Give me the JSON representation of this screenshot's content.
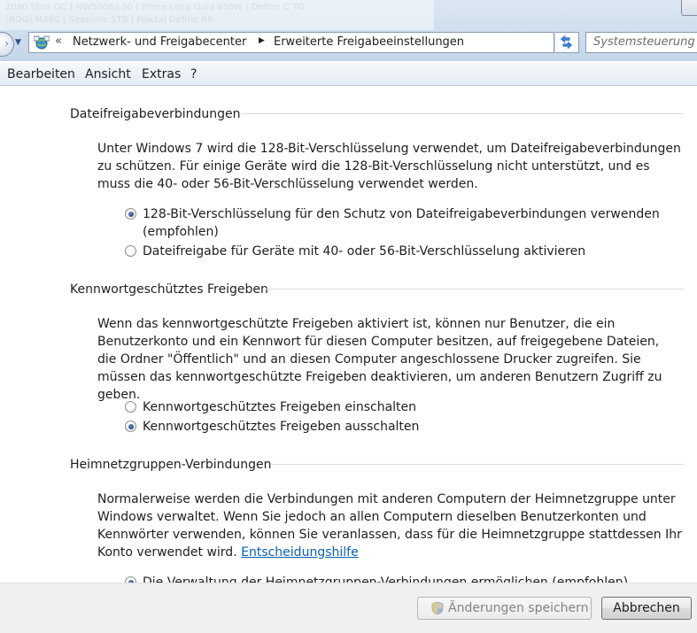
{
  "titlebar": {
    "background_text_1": "2080 Strix OC | NW5008/L00 | Prime Ultra Gold 650W | Define C TG",
    "background_text_2": "(ROG) MX80 | Seasonic 1TB | Fractal Define R6"
  },
  "address": {
    "overflow_chevrons": "«",
    "crumb_1": "Netzwerk- und Freigabecenter",
    "crumb_separator": "▶",
    "crumb_2": "Erweiterte Freigabeeinstellungen"
  },
  "search": {
    "placeholder": "Systemsteuerung d"
  },
  "menu": {
    "items": [
      "Bearbeiten",
      "Ansicht",
      "Extras",
      "?"
    ]
  },
  "sections": [
    {
      "heading": "Dateifreigabeverbindungen",
      "description": "Unter Windows 7 wird die 128-Bit-Verschlüsselung verwendet, um Dateifreigabeverbindungen zu schützen. Für einige Geräte wird die 128-Bit-Verschlüsselung nicht unterstützt, und es muss die 40- oder 56-Bit-Verschlüsselung verwendet werden.",
      "options": [
        {
          "label": "128-Bit-Verschlüsselung für den Schutz von Dateifreigabeverbindungen verwenden (empfohlen)",
          "checked": true
        },
        {
          "label": "Dateifreigabe für Geräte mit 40- oder 56-Bit-Verschlüsselung aktivieren",
          "checked": false
        }
      ]
    },
    {
      "heading": "Kennwortgeschütztes Freigeben",
      "description": "Wenn das kennwortgeschützte Freigeben aktiviert ist, können nur Benutzer, die ein Benutzerkonto und ein Kennwort für diesen Computer besitzen, auf freigegebene Dateien, die Ordner \"Öffentlich\" und an diesen Computer angeschlossene Drucker zugreifen. Sie müssen das kennwortgeschützte Freigeben deaktivieren, um anderen Benutzern Zugriff zu geben.",
      "options": [
        {
          "label": "Kennwortgeschütztes Freigeben einschalten",
          "checked": false
        },
        {
          "label": "Kennwortgeschütztes Freigeben ausschalten",
          "checked": true
        }
      ]
    },
    {
      "heading": "Heimnetzgruppen-Verbindungen",
      "description": "Normalerweise werden die Verbindungen mit anderen Computern der Heimnetzgruppe unter Windows verwaltet. Wenn Sie jedoch an allen Computern dieselben Benutzerkonten und Kennwörter verwenden, können Sie veranlassen, dass für die Heimnetzgruppe stattdessen Ihr Konto verwendet wird.",
      "help_link": "Entscheidungshilfe",
      "options": [
        {
          "label": "Die Verwaltung der Heimnetzgruppen-Verbindungen ermöglichen (empfohlen)",
          "checked": true
        }
      ]
    }
  ],
  "footer": {
    "save_label": "Änderungen speichern",
    "cancel_label": "Abbrechen"
  }
}
